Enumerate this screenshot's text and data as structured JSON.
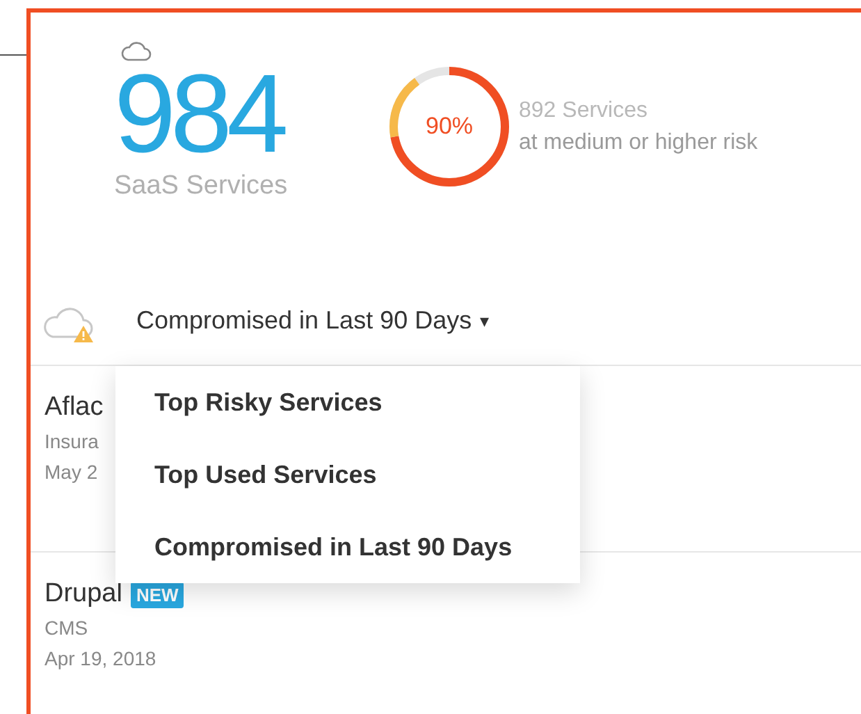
{
  "summary": {
    "count": "984",
    "label": "SaaS Services"
  },
  "risk": {
    "level": 0.9,
    "percent": "90%",
    "count": "892 Services",
    "caption": "at medium or higher risk"
  },
  "filter": {
    "label": "Compromised in Last 90 Days",
    "caret": "▾",
    "expanded": true,
    "options": [
      {
        "label": "Top Risky Services"
      },
      {
        "label": "Top Used Services"
      },
      {
        "label": "Compromised in Last 90 Days"
      }
    ]
  },
  "services": [
    {
      "name": "Aflac",
      "category": "Insura",
      "date": "May 2"
    },
    {
      "name": "Drupal",
      "badge": "NEW",
      "category": "CMS",
      "date": "Apr 19, 2018"
    }
  ]
}
